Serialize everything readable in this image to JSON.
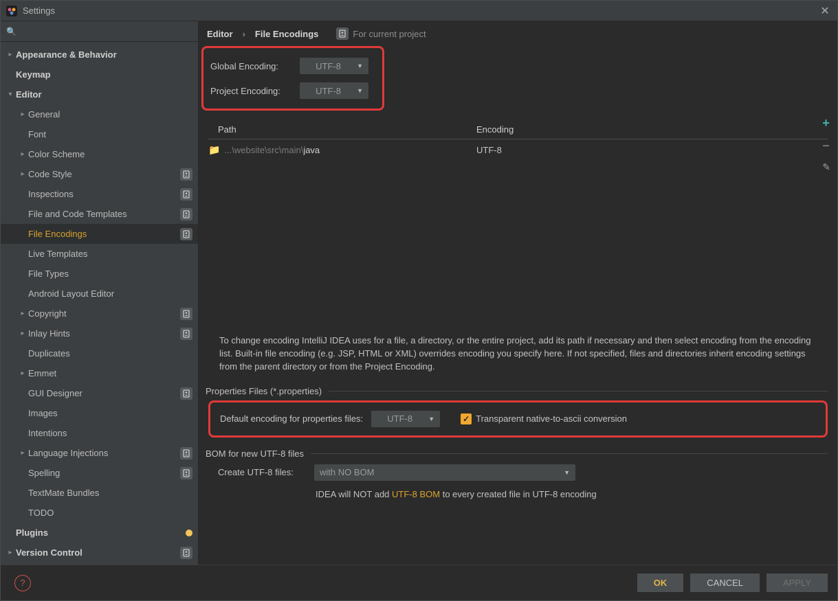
{
  "window": {
    "title": "Settings",
    "closeGlyph": "✕"
  },
  "search": {
    "placeholder": ""
  },
  "sidebar": {
    "items": [
      {
        "label": "Appearance & Behavior",
        "depth": 0,
        "arrow": "right",
        "bold": true
      },
      {
        "label": "Keymap",
        "depth": 0,
        "bold": true
      },
      {
        "label": "Editor",
        "depth": 0,
        "arrow": "down",
        "bold": true
      },
      {
        "label": "General",
        "depth": 1,
        "arrow": "right"
      },
      {
        "label": "Font",
        "depth": 1
      },
      {
        "label": "Color Scheme",
        "depth": 1,
        "arrow": "right"
      },
      {
        "label": "Code Style",
        "depth": 1,
        "arrow": "right",
        "badge": "project"
      },
      {
        "label": "Inspections",
        "depth": 1,
        "badge": "project"
      },
      {
        "label": "File and Code Templates",
        "depth": 1,
        "badge": "project"
      },
      {
        "label": "File Encodings",
        "depth": 1,
        "badge": "project",
        "selected": true
      },
      {
        "label": "Live Templates",
        "depth": 1
      },
      {
        "label": "File Types",
        "depth": 1
      },
      {
        "label": "Android Layout Editor",
        "depth": 1
      },
      {
        "label": "Copyright",
        "depth": 1,
        "arrow": "right",
        "badge": "project"
      },
      {
        "label": "Inlay Hints",
        "depth": 1,
        "arrow": "right",
        "badge": "project"
      },
      {
        "label": "Duplicates",
        "depth": 1
      },
      {
        "label": "Emmet",
        "depth": 1,
        "arrow": "right"
      },
      {
        "label": "GUI Designer",
        "depth": 1,
        "badge": "project"
      },
      {
        "label": "Images",
        "depth": 1
      },
      {
        "label": "Intentions",
        "depth": 1
      },
      {
        "label": "Language Injections",
        "depth": 1,
        "arrow": "right",
        "badge": "project"
      },
      {
        "label": "Spelling",
        "depth": 1,
        "badge": "project"
      },
      {
        "label": "TextMate Bundles",
        "depth": 1
      },
      {
        "label": "TODO",
        "depth": 1
      },
      {
        "label": "Plugins",
        "depth": 0,
        "bold": true,
        "badge": "dot"
      },
      {
        "label": "Version Control",
        "depth": 0,
        "arrow": "right",
        "bold": true,
        "badge": "project"
      }
    ]
  },
  "breadcrumb": {
    "a": "Editor",
    "sep": "›",
    "b": "File Encodings",
    "forProject": "For current project"
  },
  "globalEncoding": {
    "label": "Global Encoding:",
    "value": "UTF-8"
  },
  "projectEncoding": {
    "label": "Project Encoding:",
    "value": "UTF-8"
  },
  "table": {
    "headers": {
      "path": "Path",
      "encoding": "Encoding"
    },
    "rows": [
      {
        "pathGrey": "...\\website\\src\\main\\",
        "pathWhite": "java",
        "encoding": "UTF-8"
      }
    ],
    "actions": {
      "addGlyph": "+",
      "removeGlyph": "−",
      "editGlyph": "✎"
    }
  },
  "infoText": "To change encoding IntelliJ IDEA uses for a file, a directory, or the entire project, add its path if necessary and then select encoding from the encoding list. Built-in file encoding (e.g. JSP, HTML or XML) overrides encoding you specify here. If not specified, files and directories inherit encoding settings from the parent directory or from the Project Encoding.",
  "propsSection": {
    "title": "Properties Files (*.properties)",
    "defaultLabel": "Default encoding for properties files:",
    "defaultValue": "UTF-8",
    "checkboxLabel": "Transparent native-to-ascii conversion"
  },
  "bomSection": {
    "title": "BOM for new UTF-8 files",
    "createLabel": "Create UTF-8 files:",
    "createValue": "with NO BOM",
    "infoPrefix": "IDEA will NOT add ",
    "infoGold": "UTF-8 BOM",
    "infoSuffix": " to every created file in UTF-8 encoding"
  },
  "footer": {
    "helpGlyph": "?",
    "ok": "OK",
    "cancel": "CANCEL",
    "apply": "APPLY"
  }
}
